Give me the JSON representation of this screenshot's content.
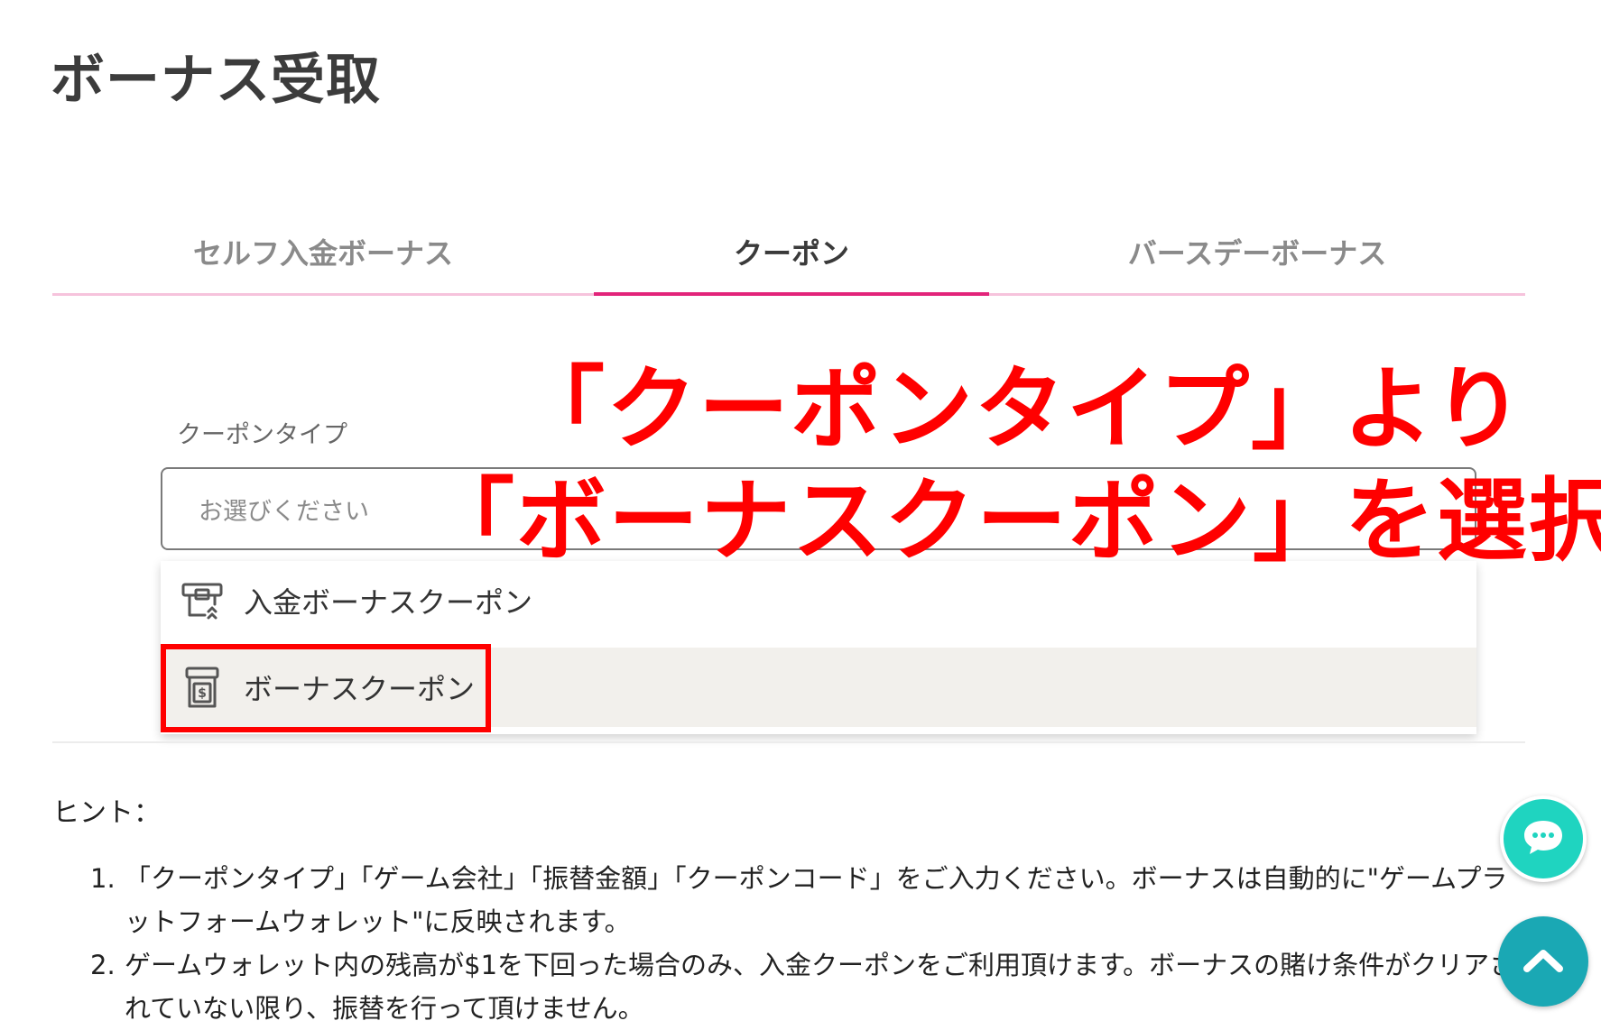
{
  "page": {
    "title": "ボーナス受取"
  },
  "tabs": [
    {
      "label": "セルフ入金ボーナス"
    },
    {
      "label": "クーポン"
    },
    {
      "label": "バースデーボーナス"
    }
  ],
  "form": {
    "coupon_type_label": "クーポンタイプ",
    "select_placeholder": "お選びください"
  },
  "dropdown": {
    "items": [
      {
        "label": "入金ボーナスクーポン",
        "icon": "deposit-coupon-icon"
      },
      {
        "label": "ボーナスクーポン",
        "icon": "bonus-coupon-icon"
      }
    ]
  },
  "annotation": {
    "line1": "「クーポンタイプ」より",
    "line2": "「ボーナスクーポン」を選択",
    "color": "#ff0000"
  },
  "hint": {
    "title": "ヒント：",
    "items": [
      {
        "num": "1.",
        "text": "「クーポンタイプ」「ゲーム会社」「振替金額」「クーポンコード」をご入力ください。ボーナスは自動的に\"ゲームプラットフォームウォレット\"に反映されます。"
      },
      {
        "num": "2.",
        "text": "ゲームウォレット内の残高が$1を下回った場合のみ、入金クーポンをご利用頂けます。ボーナスの賭け条件がクリアされていない限り、振替を行って頂けません。"
      }
    ]
  },
  "colors": {
    "accent": "#e2247a",
    "tab_underline": "#f6c3dc",
    "chat_button": "#1fd4c0",
    "scroll_top_button": "#1aa8b4"
  }
}
